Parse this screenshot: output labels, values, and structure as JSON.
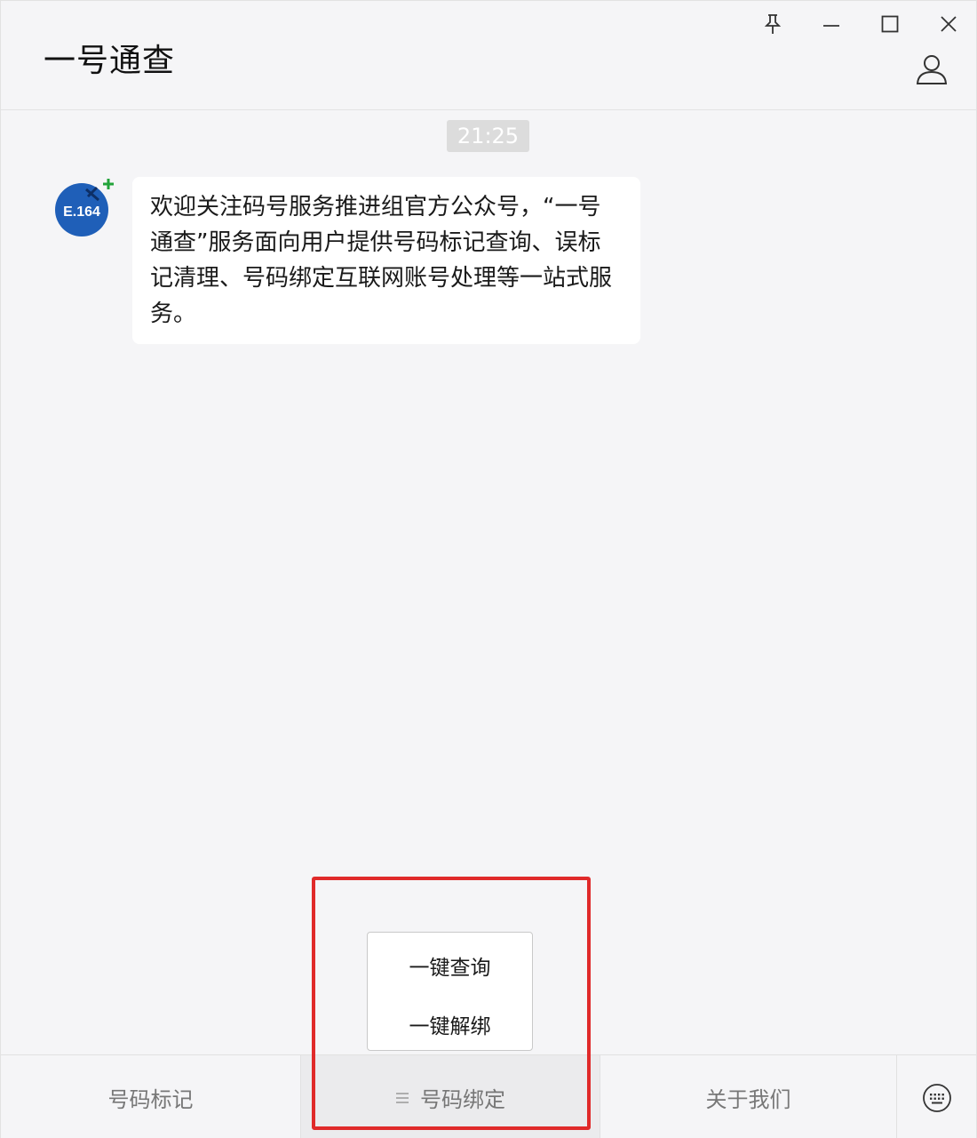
{
  "window": {
    "title": "一号通查"
  },
  "controls": {
    "pin_icon": "pin-icon",
    "minimize_icon": "minimize-icon",
    "maximize_icon": "maximize-icon",
    "close_icon": "close-icon",
    "profile_icon": "person-icon"
  },
  "chat": {
    "timestamp": "21:25",
    "avatar_text": "E.164",
    "message": "欢迎关注码号服务推进组官方公众号，“一号通查”服务面向用户提供号码标记查询、误标记清理、号码绑定互联网账号处理等一站式服务。"
  },
  "popup_menu": {
    "items": [
      "一键查询",
      "一键解绑"
    ]
  },
  "bottom_menu": {
    "items": [
      {
        "label": "号码标记"
      },
      {
        "label": "号码绑定",
        "icon": "menu-lines-icon"
      },
      {
        "label": "关于我们"
      }
    ],
    "keyboard_icon": "keyboard-icon"
  },
  "colors": {
    "highlight_box": "#e02a2a",
    "avatar_blue": "#1f5fb8",
    "avatar_plus": "#22a33a"
  }
}
